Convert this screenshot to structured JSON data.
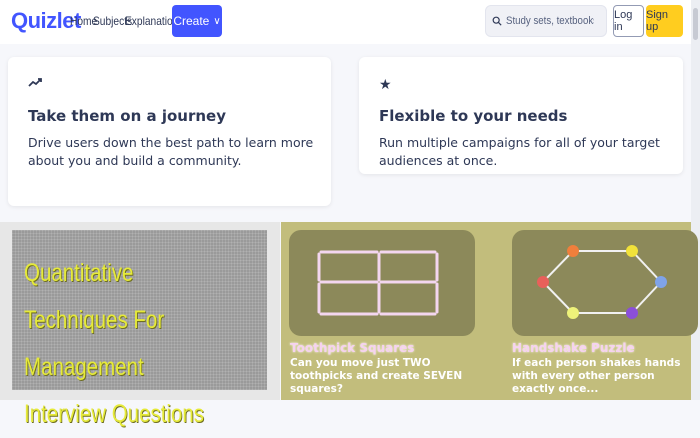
{
  "header": {
    "logo": "Quizlet",
    "nav": [
      "Home",
      "Subjects",
      "Explanations"
    ],
    "create_label": "Create",
    "search_placeholder": "Study sets, textbooks, ...",
    "login_label": "Log in",
    "signup_label": "Sign up",
    "colors": {
      "brand": "#4255ff",
      "signup": "#ffcd1f"
    }
  },
  "features": [
    {
      "icon": "trending-up-icon",
      "title": "Take them on a journey",
      "description": "Drive users down the best path to learn more about you and build a community."
    },
    {
      "icon": "star-icon",
      "title": "Flexible to your needs",
      "description": "Run multiple campaigns for all of your target audiences at once."
    }
  ],
  "content": {
    "left_thumb_text": "Quantitative Techniques For Management Interview Questions",
    "puzzles": [
      {
        "title": "Toothpick Squares",
        "description": "Can you move just TWO toothpicks and create SEVEN squares?"
      },
      {
        "title": "Handshake Puzzle",
        "description": "If each person shakes hands with every other person exactly once..."
      }
    ]
  }
}
